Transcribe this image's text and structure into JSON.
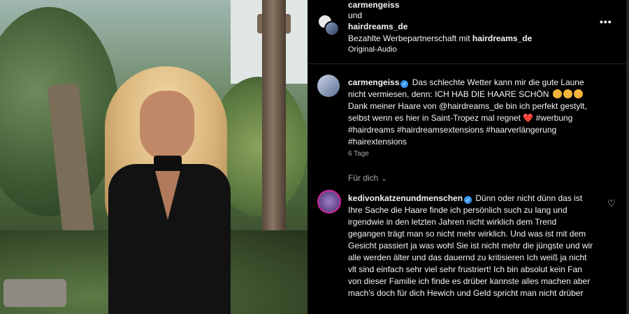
{
  "header": {
    "user1": "carmengeiss",
    "and_text": "und",
    "user2": "hairdreams_de",
    "partner_prefix": "Bezahlte Werbepartnerschaft mit ",
    "partner_name": "hairdreams_de",
    "audio": "Original-Audio",
    "more_label": "•••"
  },
  "caption": {
    "user": "carmengeiss",
    "text_part1": " Das schlechte Wetter kann mir die gute Laune nicht vermiesen, denn: ICH HAB DIE HAARE SCHÖN ",
    "text_part2": " Dank meiner Haare von @hairdreams_de bin ich perfekt gestylt, selbst wenn es hier in Saint-Tropez mal regnet ",
    "heart": "❤️",
    "text_part3": " #werbung #hairdreams #hairdreamsextensions #haarverlängerung #hairextensions",
    "time": "6 Tage"
  },
  "sort": {
    "label": "Für dich",
    "chevron": "⌄"
  },
  "comment": {
    "user": "kedivonkatzenundmenschen",
    "text": " Dünn oder nicht dünn das ist Ihre Sache die Haare finde ich persönlich such zu lang und irgendwie in den letzten Jahren nicht wirklich dem Trend gegangen trägt man so nicht mehr wirklich. Und was ist mit dem Gesicht passiert ja was wohl Sie ist nicht mehr die jüngste und wir alle werden älter und das dauernd zu kritisieren Ich weiß ja nicht vlt sind einfach sehr viel sehr frustriert! Ich bin absolut kein Fan von dieser Familie ich finde es drüber kannste alles machen aber mach's doch für dich Hewich und Geld spricht man nicht drüber",
    "like_icon": "♡"
  },
  "colors": {
    "background": "#000000",
    "text": "#f5f5f5",
    "secondary": "#a8a8a8",
    "verified": "#3897f0"
  }
}
